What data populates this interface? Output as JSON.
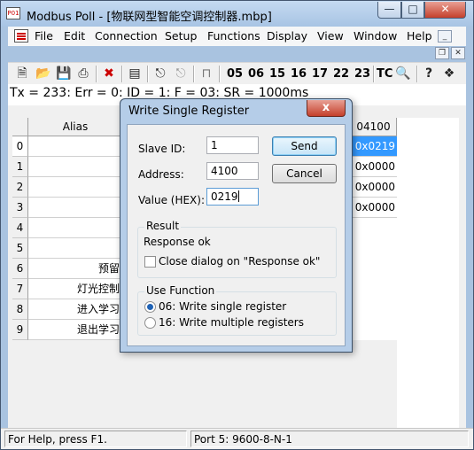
{
  "window": {
    "title": "Modbus Poll - [物联网型智能空调控制器.mbp]",
    "app_icon_text": "P01"
  },
  "menu": {
    "items": [
      "File",
      "Edit",
      "Connection",
      "Setup",
      "Functions",
      "Display",
      "View",
      "Window",
      "Help"
    ]
  },
  "toolbar": {
    "function_codes": [
      "05",
      "06",
      "15",
      "16",
      "17",
      "22",
      "23"
    ],
    "tc_label": "TC"
  },
  "document": {
    "status_line": "Tx = 233: Err = 0: ID = 1: F = 03: SR = 1000ms",
    "columns": {
      "alias": "Alias",
      "address": "04100"
    },
    "rows": [
      {
        "num": "0",
        "alias": "",
        "value": "0x0219"
      },
      {
        "num": "1",
        "alias": "",
        "value": "0x0000"
      },
      {
        "num": "2",
        "alias": "",
        "value": "0x0000"
      },
      {
        "num": "3",
        "alias": "",
        "value": "0x0000"
      },
      {
        "num": "4",
        "alias": "",
        "value": ""
      },
      {
        "num": "5",
        "alias": "",
        "value": ""
      },
      {
        "num": "6",
        "alias": "预留",
        "value": ""
      },
      {
        "num": "7",
        "alias": "灯光控制",
        "value": ""
      },
      {
        "num": "8",
        "alias": "进入学习",
        "value": ""
      },
      {
        "num": "9",
        "alias": "退出学习",
        "value": ""
      }
    ]
  },
  "statusbar": {
    "help": "For Help, press F1.",
    "port": "Port 5: 9600-8-N-1"
  },
  "dialog": {
    "title": "Write Single Register",
    "close_glyph": "x",
    "slave_id_label": "Slave ID:",
    "slave_id_value": "1",
    "address_label": "Address:",
    "address_value": "4100",
    "value_label": "Value (HEX):",
    "value_value": "0219",
    "send_label": "Send",
    "cancel_label": "Cancel",
    "result_group": "Result",
    "result_text": "Response ok",
    "close_on_ok_label": "Close dialog on \"Response ok\"",
    "close_on_ok_checked": false,
    "function_group": "Use Function",
    "function_options": [
      {
        "label": "06: Write single register",
        "selected": true
      },
      {
        "label": "16: Write multiple registers",
        "selected": false
      }
    ]
  }
}
